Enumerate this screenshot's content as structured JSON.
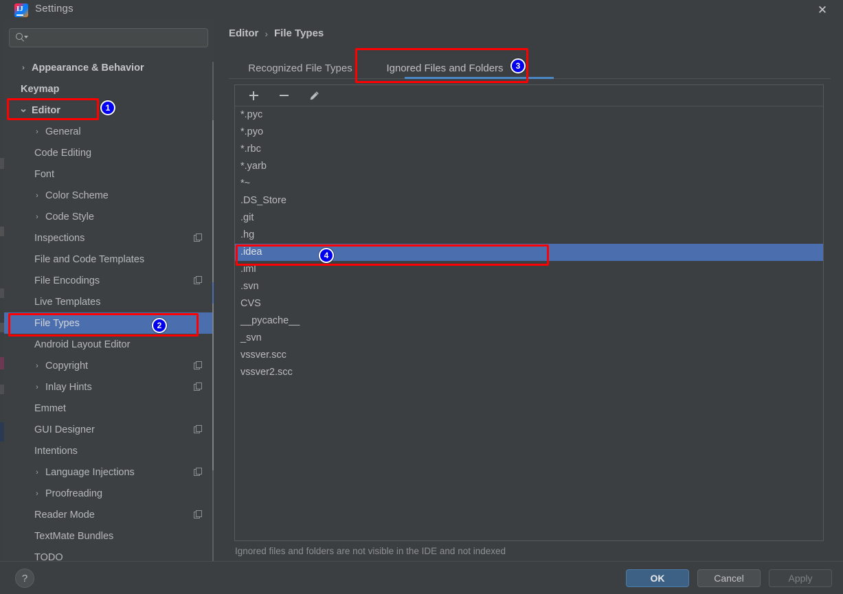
{
  "window": {
    "title": "Settings",
    "logo_icon": "intellij-idea-logo",
    "close_icon": "close-icon"
  },
  "search": {
    "value": "",
    "placeholder": "",
    "icon": "search-icon"
  },
  "sidebar": {
    "scroll_thumb_icon": "scrollbar-thumb",
    "items": [
      {
        "label": "Appearance & Behavior",
        "level": 1,
        "chevron": "chevron-right-icon",
        "bold": true,
        "selected": false,
        "copy_icon": false
      },
      {
        "label": "Keymap",
        "level": 1,
        "chevron": "",
        "bold": true,
        "selected": false,
        "copy_icon": false
      },
      {
        "label": "Editor",
        "level": 1,
        "chevron": "chevron-down-icon",
        "bold": true,
        "selected": false,
        "copy_icon": false
      },
      {
        "label": "General",
        "level": 2,
        "chevron": "chevron-right-icon",
        "bold": false,
        "selected": false,
        "copy_icon": false
      },
      {
        "label": "Code Editing",
        "level": 2,
        "chevron": "",
        "bold": false,
        "selected": false,
        "copy_icon": false
      },
      {
        "label": "Font",
        "level": 2,
        "chevron": "",
        "bold": false,
        "selected": false,
        "copy_icon": false
      },
      {
        "label": "Color Scheme",
        "level": 2,
        "chevron": "chevron-right-icon",
        "bold": false,
        "selected": false,
        "copy_icon": false
      },
      {
        "label": "Code Style",
        "level": 2,
        "chevron": "chevron-right-icon",
        "bold": false,
        "selected": false,
        "copy_icon": false
      },
      {
        "label": "Inspections",
        "level": 2,
        "chevron": "",
        "bold": false,
        "selected": false,
        "copy_icon": true
      },
      {
        "label": "File and Code Templates",
        "level": 2,
        "chevron": "",
        "bold": false,
        "selected": false,
        "copy_icon": false
      },
      {
        "label": "File Encodings",
        "level": 2,
        "chevron": "",
        "bold": false,
        "selected": false,
        "copy_icon": true
      },
      {
        "label": "Live Templates",
        "level": 2,
        "chevron": "",
        "bold": false,
        "selected": false,
        "copy_icon": false
      },
      {
        "label": "File Types",
        "level": 2,
        "chevron": "",
        "bold": false,
        "selected": true,
        "copy_icon": false
      },
      {
        "label": "Android Layout Editor",
        "level": 2,
        "chevron": "",
        "bold": false,
        "selected": false,
        "copy_icon": false
      },
      {
        "label": "Copyright",
        "level": 2,
        "chevron": "chevron-right-icon",
        "bold": false,
        "selected": false,
        "copy_icon": true
      },
      {
        "label": "Inlay Hints",
        "level": 2,
        "chevron": "chevron-right-icon",
        "bold": false,
        "selected": false,
        "copy_icon": true
      },
      {
        "label": "Emmet",
        "level": 2,
        "chevron": "",
        "bold": false,
        "selected": false,
        "copy_icon": false
      },
      {
        "label": "GUI Designer",
        "level": 2,
        "chevron": "",
        "bold": false,
        "selected": false,
        "copy_icon": true
      },
      {
        "label": "Intentions",
        "level": 2,
        "chevron": "",
        "bold": false,
        "selected": false,
        "copy_icon": false
      },
      {
        "label": "Language Injections",
        "level": 2,
        "chevron": "chevron-right-icon",
        "bold": false,
        "selected": false,
        "copy_icon": true
      },
      {
        "label": "Proofreading",
        "level": 2,
        "chevron": "chevron-right-icon",
        "bold": false,
        "selected": false,
        "copy_icon": false
      },
      {
        "label": "Reader Mode",
        "level": 2,
        "chevron": "",
        "bold": false,
        "selected": false,
        "copy_icon": true
      },
      {
        "label": "TextMate Bundles",
        "level": 2,
        "chevron": "",
        "bold": false,
        "selected": false,
        "copy_icon": false
      },
      {
        "label": "TODO",
        "level": 2,
        "chevron": "",
        "bold": false,
        "selected": false,
        "copy_icon": false
      }
    ]
  },
  "main": {
    "breadcrumb": {
      "root": "Editor",
      "separator": "›",
      "leaf": "File Types"
    },
    "tabs": [
      {
        "label": "Recognized File Types",
        "active": false
      },
      {
        "label": "Ignored Files and Folders",
        "active": true
      }
    ],
    "toolbar": {
      "add_icon": "plus-icon",
      "remove_icon": "minus-icon",
      "edit_icon": "pencil-icon"
    },
    "ignored_items": [
      {
        "label": "*.pyc",
        "selected": false
      },
      {
        "label": "*.pyo",
        "selected": false
      },
      {
        "label": "*.rbc",
        "selected": false
      },
      {
        "label": "*.yarb",
        "selected": false
      },
      {
        "label": "*~",
        "selected": false
      },
      {
        "label": ".DS_Store",
        "selected": false
      },
      {
        "label": ".git",
        "selected": false
      },
      {
        "label": ".hg",
        "selected": false
      },
      {
        "label": ".idea",
        "selected": true
      },
      {
        "label": ".iml",
        "selected": false
      },
      {
        "label": ".svn",
        "selected": false
      },
      {
        "label": "CVS",
        "selected": false
      },
      {
        "label": "__pycache__",
        "selected": false
      },
      {
        "label": "_svn",
        "selected": false
      },
      {
        "label": "vssver.scc",
        "selected": false
      },
      {
        "label": "vssver2.scc",
        "selected": false
      }
    ],
    "hint": "Ignored files and folders are not visible in the IDE and not indexed"
  },
  "footer": {
    "help_label": "?",
    "help_icon": "question-mark-icon",
    "ok_label": "OK",
    "cancel_label": "Cancel",
    "apply_label": "Apply"
  },
  "annotations": {
    "accent_red": "#fe0000",
    "badge_blue": "#0000ee",
    "selection_blue": "#4b6eaf",
    "markers": [
      {
        "number": "1",
        "target": "sidebar-item-editor"
      },
      {
        "number": "2",
        "target": "sidebar-item-file-types"
      },
      {
        "number": "3",
        "target": "tab-ignored-files-and-folders"
      },
      {
        "number": "4",
        "target": "list-item-idea"
      }
    ]
  }
}
